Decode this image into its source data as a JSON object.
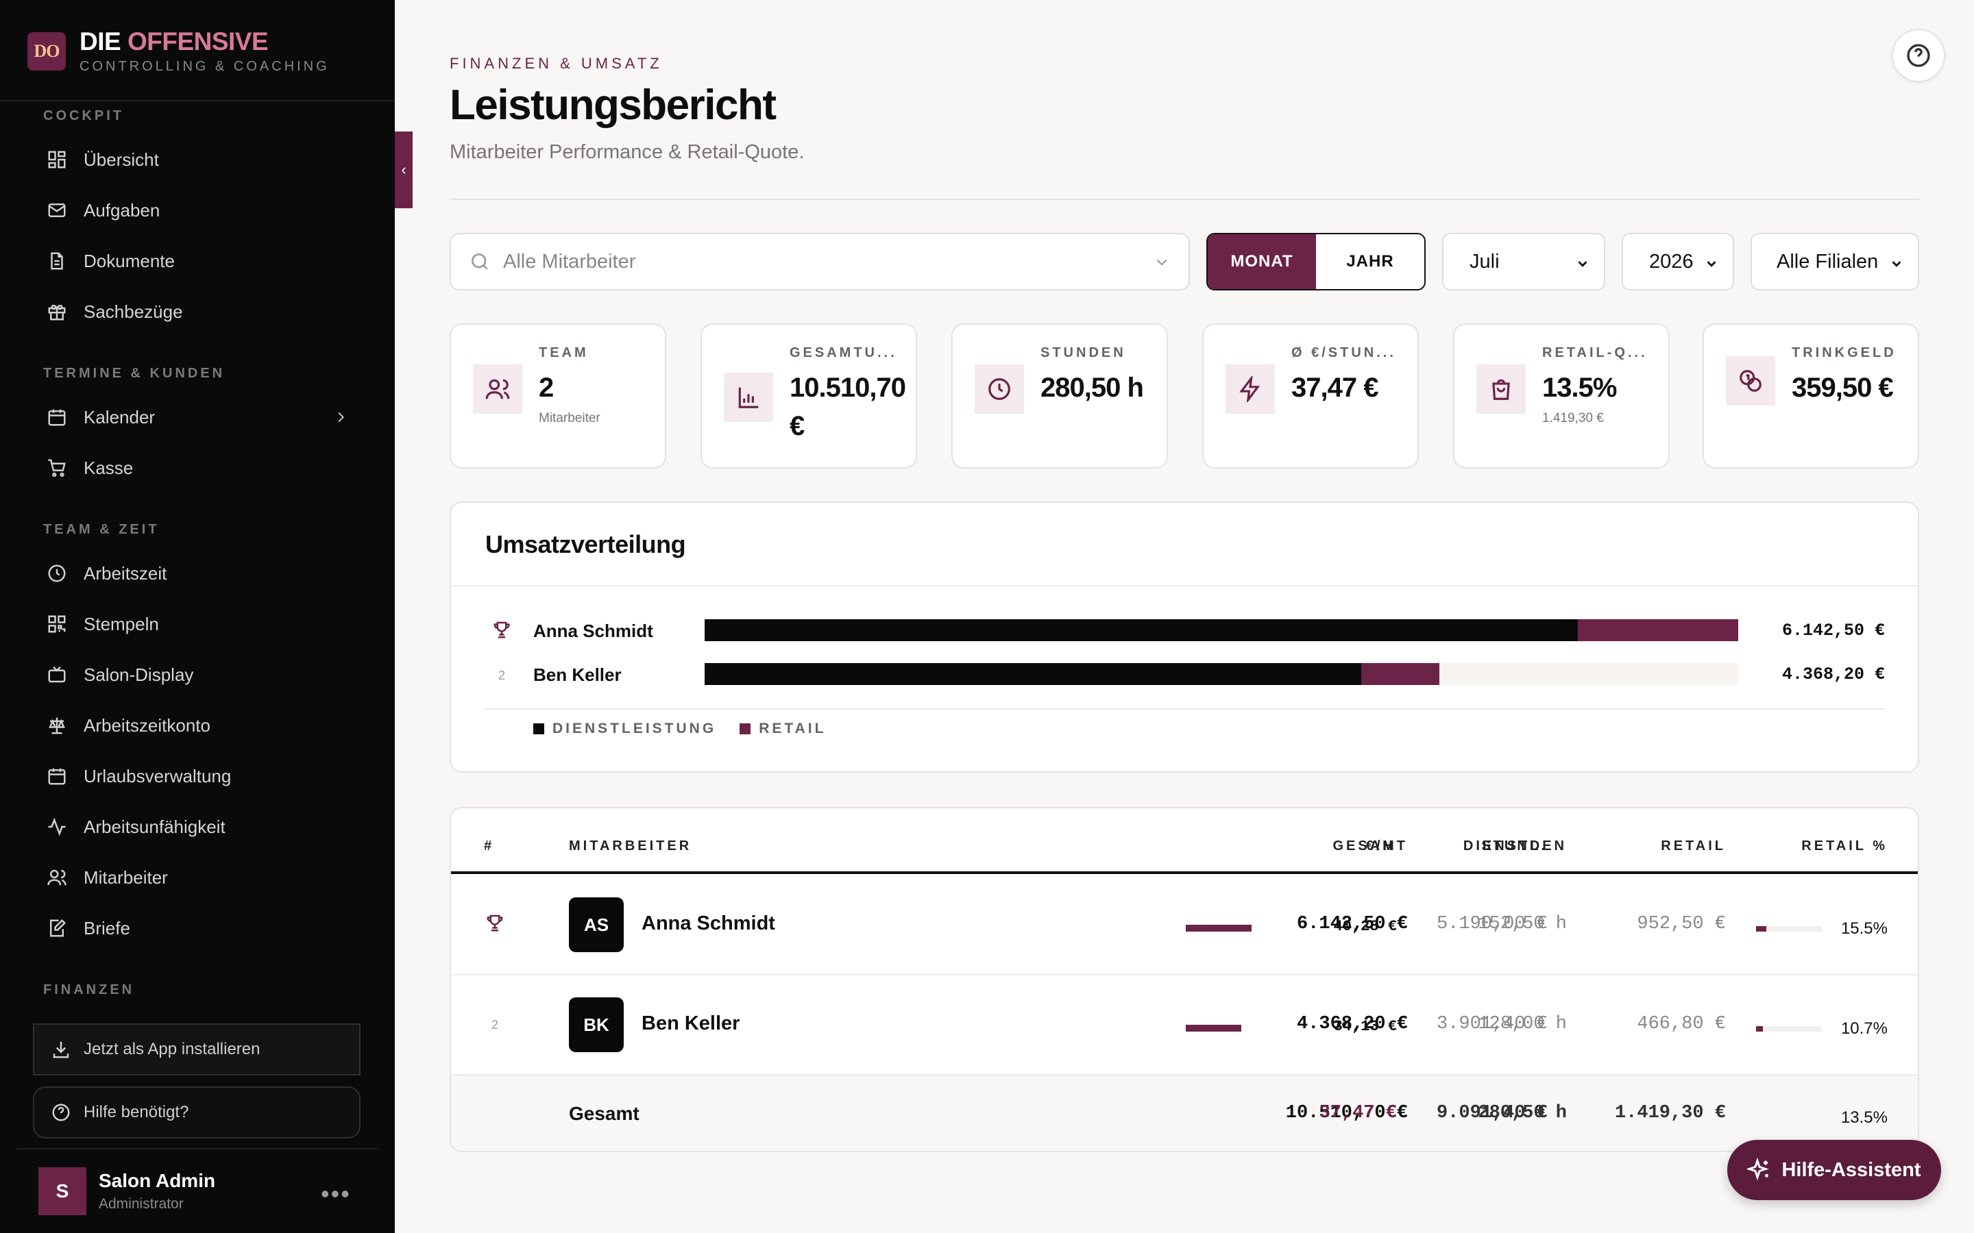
{
  "brand": {
    "logo": "DO",
    "title_a": "DIE",
    "title_b": "OFFENSIVE",
    "subtitle": "CONTROLLING & COACHING"
  },
  "sidebar": {
    "sections": {
      "cockpit": "COCKPIT",
      "termine": "TERMINE & KUNDEN",
      "team": "TEAM & ZEIT",
      "finanzen": "FINANZEN"
    },
    "items": [
      {
        "label": "Übersicht",
        "icon": "grid-icon"
      },
      {
        "label": "Aufgaben",
        "icon": "mail-icon"
      },
      {
        "label": "Dokumente",
        "icon": "file-icon"
      },
      {
        "label": "Sachbezüge",
        "icon": "gift-icon"
      },
      {
        "label": "Kalender",
        "icon": "calendar-icon"
      },
      {
        "label": "Kasse",
        "icon": "cart-icon"
      },
      {
        "label": "Arbeitszeit",
        "icon": "clock-icon"
      },
      {
        "label": "Stempeln",
        "icon": "qr-icon"
      },
      {
        "label": "Salon-Display",
        "icon": "tv-icon"
      },
      {
        "label": "Arbeitszeitkonto",
        "icon": "scale-icon"
      },
      {
        "label": "Urlaubsverwaltung",
        "icon": "calendar-icon"
      },
      {
        "label": "Arbeitsunfähigkeit",
        "icon": "activity-icon"
      },
      {
        "label": "Mitarbeiter",
        "icon": "users-icon"
      },
      {
        "label": "Briefe",
        "icon": "edit-icon"
      }
    ],
    "install_label": "Jetzt als App installieren",
    "help_label": "Hilfe benötigt?",
    "user": {
      "initial": "S",
      "name": "Salon Admin",
      "role": "Administrator"
    }
  },
  "header": {
    "eyebrow": "FINANZEN & UMSATZ",
    "title": "Leistungsbericht",
    "subtitle": "Mitarbeiter Performance & Retail-Quote."
  },
  "filters": {
    "search_placeholder": "Alle Mitarbeiter",
    "toggle": [
      "MONAT",
      "JAHR"
    ],
    "month": "Juli",
    "year": "2026",
    "branch": "Alle Filialen"
  },
  "kpis": [
    {
      "label": "TEAM",
      "value": "2",
      "sub": "Mitarbeiter",
      "icon": "users-icon"
    },
    {
      "label": "GESAMTU...",
      "value": "10.510,70 €",
      "sub": "",
      "icon": "bar-chart-icon"
    },
    {
      "label": "STUNDEN",
      "value": "280,50 h",
      "sub": "",
      "icon": "clock-icon"
    },
    {
      "label": "Ø €/STUN...",
      "value": "37,47 €",
      "sub": "",
      "icon": "bolt-icon"
    },
    {
      "label": "RETAIL-Q...",
      "value": "13.5%",
      "sub": "1.419,30 €",
      "icon": "bag-icon"
    },
    {
      "label": "TRINKGELD",
      "value": "359,50 €",
      "sub": "",
      "icon": "coins-icon"
    }
  ],
  "distribution": {
    "title": "Umsatzverteilung",
    "max": 6142.5,
    "rows": [
      {
        "rank": "",
        "name": "Anna Schmidt",
        "service": 5190.0,
        "retail": 952.5,
        "total": "6.142,50 €"
      },
      {
        "rank": "2",
        "name": "Ben Keller",
        "service": 3901.4,
        "retail": 466.8,
        "total": "4.368,20 €"
      }
    ],
    "legend": [
      "DIENSTLEISTUNG",
      "RETAIL"
    ]
  },
  "table": {
    "headers": [
      "#",
      "MITARBEITER",
      "GESAMT",
      "STUNDEN",
      "€/H",
      "DIENSTL.",
      "RETAIL",
      "RETAIL %"
    ],
    "rows": [
      {
        "rank": "",
        "initials": "AS",
        "name": "Anna Schmidt",
        "total": "6.142,50 €",
        "hours": "152,50 h",
        "eh": "40,28 €",
        "eh_value": 40.28,
        "service": "5.190,00 €",
        "retail": "952,50 €",
        "retail_pct": "15.5%",
        "retail_frac": 0.155
      },
      {
        "rank": "2",
        "initials": "BK",
        "name": "Ben Keller",
        "total": "4.368,20 €",
        "hours": "128,00 h",
        "eh": "34,13 €",
        "eh_value": 34.13,
        "service": "3.901,40 €",
        "retail": "466,80 €",
        "retail_pct": "10.7%",
        "retail_frac": 0.107
      }
    ],
    "total": {
      "label": "Gesamt",
      "total": "10.510,70 €",
      "hours": "280,50 h",
      "eh": "37,47 €",
      "service": "9.091,40 €",
      "retail": "1.419,30 €",
      "retail_pct": "13.5%"
    }
  },
  "assistant_label": "Hilfe-Assistent",
  "colors": {
    "accent": "#6b2347",
    "dark": "#0a0a0a",
    "pink": "#d77a9a"
  }
}
